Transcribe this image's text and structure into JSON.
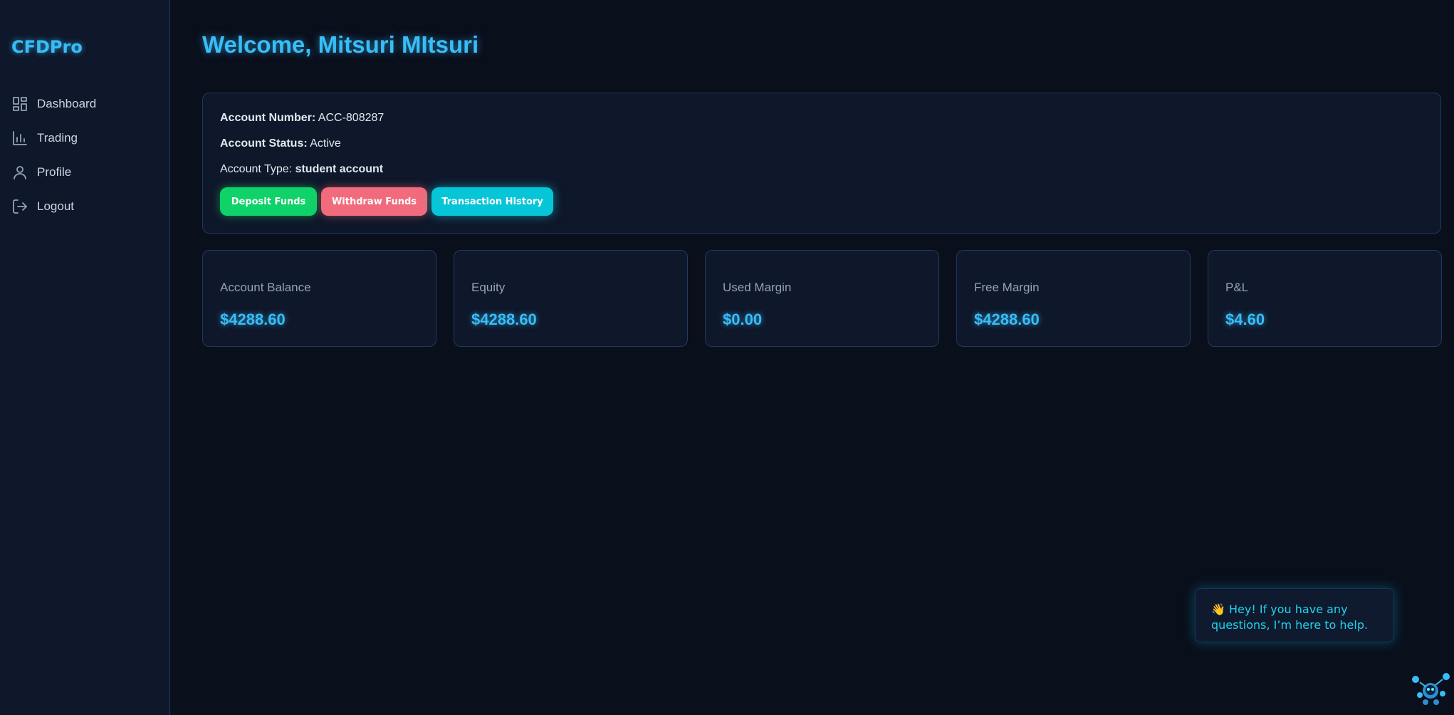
{
  "brand": "CFDPro",
  "nav": [
    {
      "label": "Dashboard",
      "icon": "dashboard-icon"
    },
    {
      "label": "Trading",
      "icon": "bar-chart-icon"
    },
    {
      "label": "Profile",
      "icon": "user-icon"
    },
    {
      "label": "Logout",
      "icon": "logout-icon"
    }
  ],
  "welcome": "Welcome, Mitsuri MItsuri",
  "account": {
    "number_label": "Account Number:",
    "number": "ACC-808287",
    "status_label": "Account Status:",
    "status": "Active",
    "type_label": "Account Type:",
    "type": "student account"
  },
  "buttons": {
    "deposit": "Deposit Funds",
    "withdraw": "Withdraw Funds",
    "history": "Transaction History"
  },
  "stats": [
    {
      "label": "Account Balance",
      "value": "$4288.60"
    },
    {
      "label": "Equity",
      "value": "$4288.60"
    },
    {
      "label": "Used Margin",
      "value": "$0.00"
    },
    {
      "label": "Free Margin",
      "value": "$4288.60"
    },
    {
      "label": "P&L",
      "value": "$4.60"
    }
  ],
  "chat": {
    "message": "👋 Hey! If you have any questions, I’m here to help."
  },
  "colors": {
    "accent": "#38bdf8",
    "deposit": "#0fd268",
    "withdraw": "#f26b7c",
    "history": "#06c5d6",
    "background": "#0a0f1c"
  }
}
